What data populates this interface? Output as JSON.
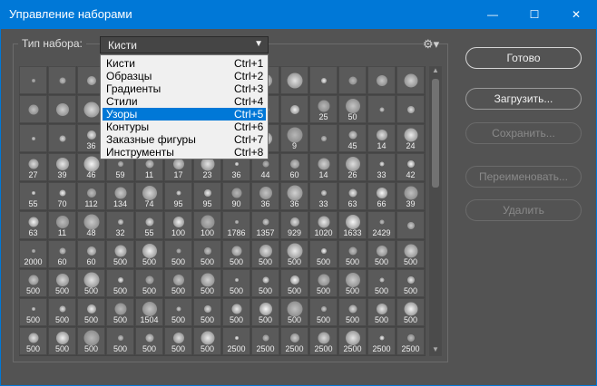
{
  "window": {
    "title": "Управление наборами",
    "minimize_glyph": "—",
    "maximize_glyph": "☐",
    "close_glyph": "✕"
  },
  "preset_type": {
    "label": "Тип набора:",
    "selected": "Кисти",
    "options": [
      {
        "label": "Кисти",
        "shortcut": "Ctrl+1"
      },
      {
        "label": "Образцы",
        "shortcut": "Ctrl+2"
      },
      {
        "label": "Градиенты",
        "shortcut": "Ctrl+3"
      },
      {
        "label": "Стили",
        "shortcut": "Ctrl+4"
      },
      {
        "label": "Узоры",
        "shortcut": "Ctrl+5"
      },
      {
        "label": "Контуры",
        "shortcut": "Ctrl+6"
      },
      {
        "label": "Заказные фигуры",
        "shortcut": "Ctrl+7"
      },
      {
        "label": "Инструменты",
        "shortcut": "Ctrl+8"
      }
    ],
    "highlighted_index": 4
  },
  "brush_grid": {
    "rows": [
      [
        "",
        "",
        "",
        "",
        "",
        "",
        "",
        "",
        "",
        "",
        "",
        "",
        "",
        ""
      ],
      [
        "",
        "",
        "",
        "",
        "",
        "",
        "",
        "",
        "",
        "",
        "25",
        "50",
        "",
        ""
      ],
      [
        "",
        "",
        "36",
        "",
        "",
        "",
        "",
        "",
        "",
        "9",
        "",
        "45",
        "14",
        "24"
      ],
      [
        "27",
        "39",
        "46",
        "59",
        "11",
        "17",
        "23",
        "36",
        "44",
        "60",
        "14",
        "26",
        "33",
        "42"
      ],
      [
        "55",
        "70",
        "112",
        "134",
        "74",
        "95",
        "95",
        "90",
        "36",
        "36",
        "33",
        "63",
        "66",
        "39"
      ],
      [
        "63",
        "11",
        "48",
        "32",
        "55",
        "100",
        "100",
        "1786",
        "1357",
        "929",
        "1020",
        "1633",
        "2429",
        ""
      ],
      [
        "2000",
        "60",
        "60",
        "500",
        "500",
        "500",
        "500",
        "500",
        "500",
        "500",
        "500",
        "500",
        "500",
        "500"
      ],
      [
        "500",
        "500",
        "500",
        "500",
        "500",
        "500",
        "500",
        "500",
        "500",
        "500",
        "500",
        "500",
        "500",
        "500"
      ],
      [
        "500",
        "500",
        "500",
        "500",
        "1504",
        "500",
        "500",
        "500",
        "500",
        "500",
        "500",
        "500",
        "500",
        "500"
      ],
      [
        "500",
        "500",
        "500",
        "500",
        "500",
        "500",
        "500",
        "2500",
        "2500",
        "2500",
        "2500",
        "2500",
        "2500",
        "2500"
      ]
    ]
  },
  "buttons": {
    "done": "Готово",
    "load": "Загрузить...",
    "save": "Сохранить...",
    "rename": "Переименовать...",
    "delete": "Удалить"
  },
  "colors": {
    "title_bar": "#0078d7",
    "dialog_bg": "#535353",
    "menu_highlight": "#0078d7"
  }
}
